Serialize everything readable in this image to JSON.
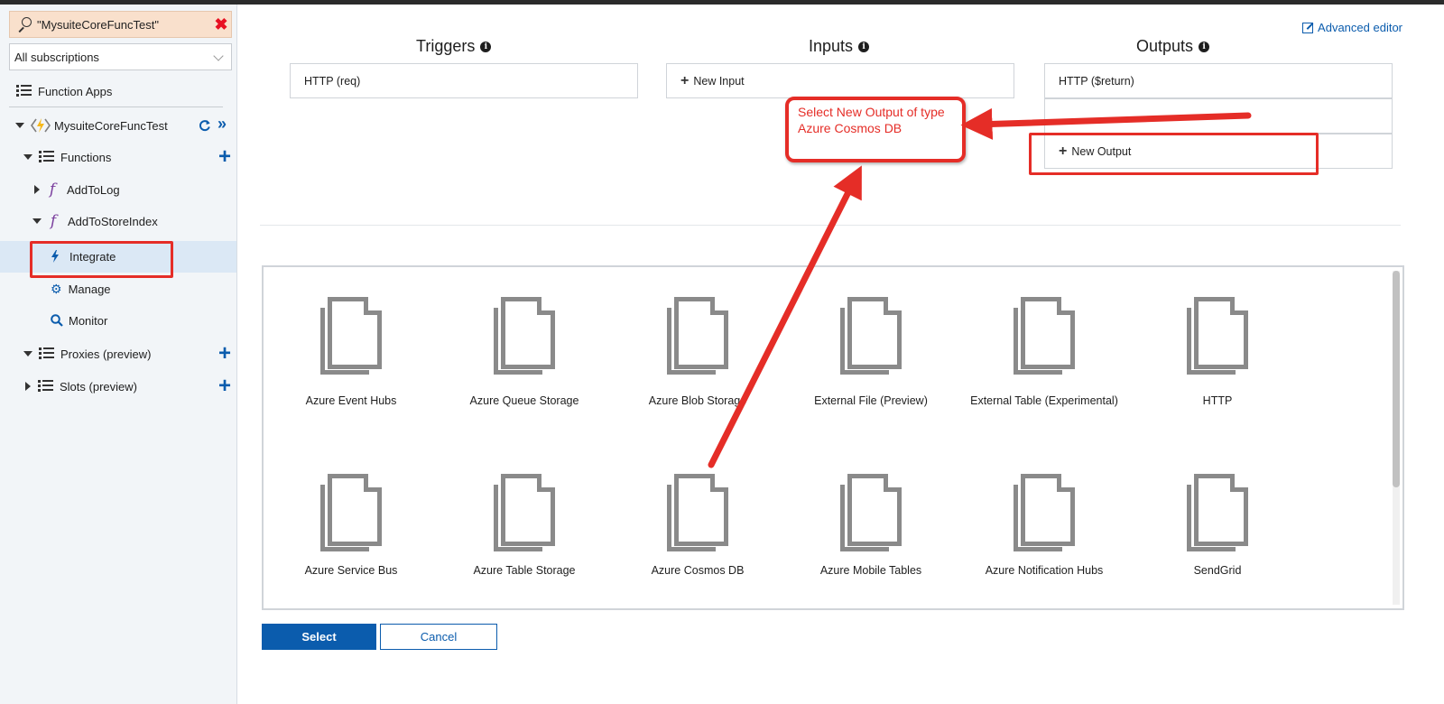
{
  "sidebar": {
    "search_value": "\"MysuiteCoreFuncTest\"",
    "subscription": "All subscriptions",
    "function_apps": "Function Apps",
    "app_name": "MysuiteCoreFuncTest",
    "functions": "Functions",
    "func1": "AddToLog",
    "func2": "AddToStoreIndex",
    "integrate": "Integrate",
    "manage": "Manage",
    "monitor": "Monitor",
    "proxies": "Proxies (preview)",
    "slots": "Slots (preview)"
  },
  "main": {
    "advanced_editor": "Advanced editor",
    "triggers_title": "Triggers",
    "inputs_title": "Inputs",
    "outputs_title": "Outputs",
    "trigger_http": "HTTP (req)",
    "new_input": "New Input",
    "output_http": "HTTP ($return)",
    "new_output": "New Output"
  },
  "gallery": {
    "tiles": [
      "Azure Event Hubs",
      "Azure Queue Storage",
      "Azure Blob Storage",
      "External File (Preview)",
      "External Table (Experimental)",
      "HTTP",
      "Azure Service Bus",
      "Azure Table Storage",
      "Azure Cosmos DB",
      "Azure Mobile Tables",
      "Azure Notification Hubs",
      "SendGrid"
    ]
  },
  "buttons": {
    "select": "Select",
    "cancel": "Cancel"
  },
  "annotation": {
    "callout_text": "Select New Output of type Azure Cosmos DB"
  },
  "colors": {
    "accent": "#0b5cad",
    "annotation": "#e52d27",
    "search_bg": "#f9e0cc",
    "selected_row": "#dbe8f5"
  }
}
